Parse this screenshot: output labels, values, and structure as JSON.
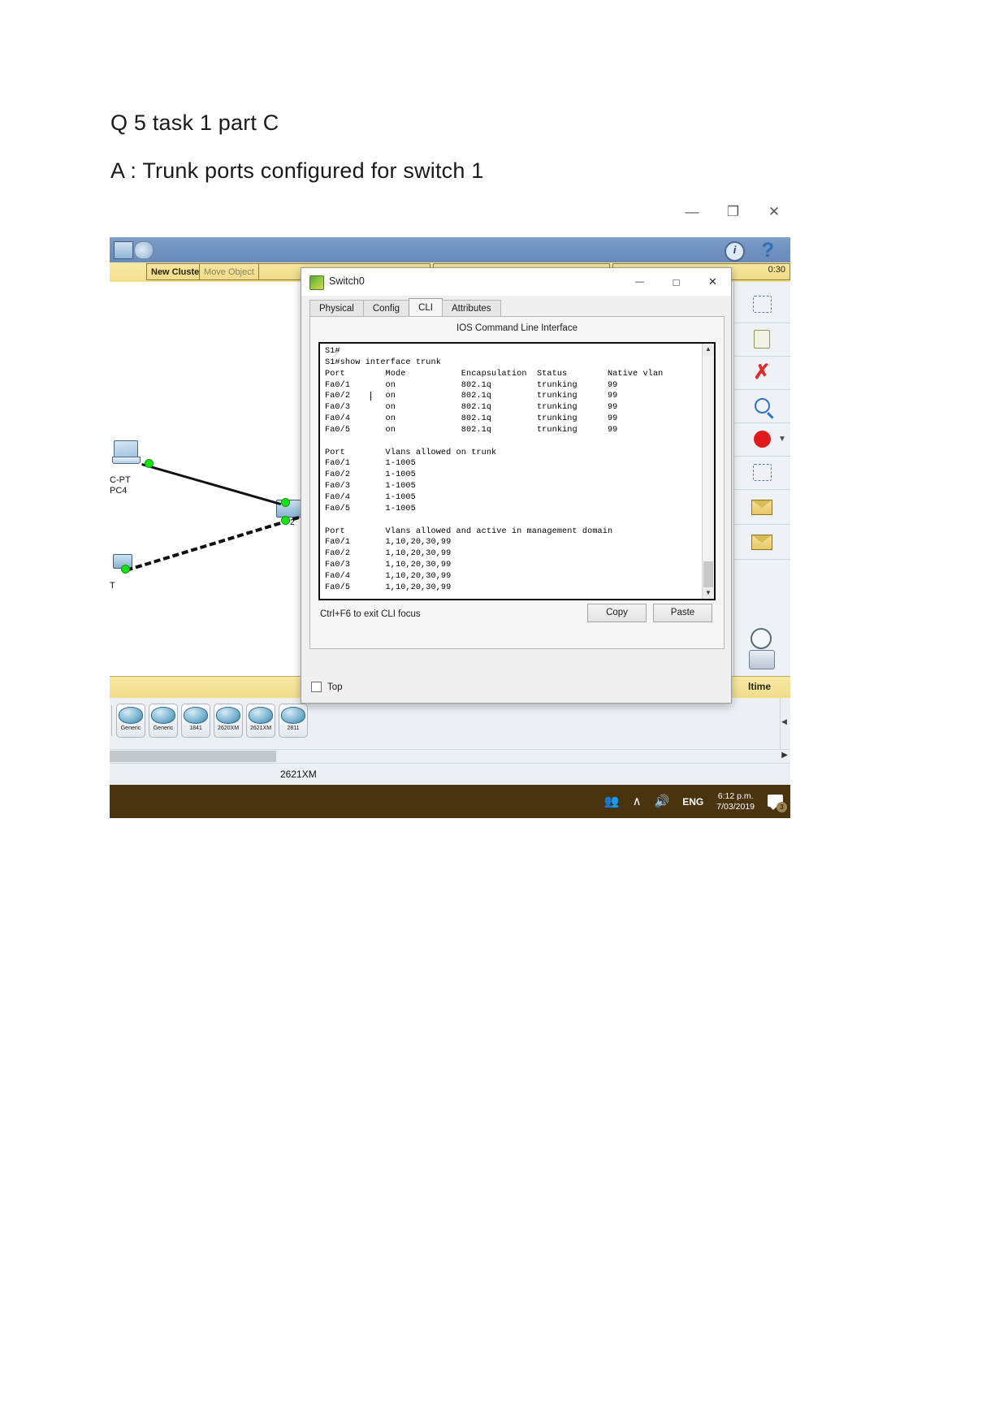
{
  "document": {
    "heading_1": "Q 5 task 1 part C",
    "heading_2": "A : Trunk ports configured for switch 1"
  },
  "os_window": {
    "minimize": "—",
    "restore": "❐",
    "close": "✕"
  },
  "packet_tracer": {
    "cluster_bar": {
      "new_cluster": "New Cluster",
      "move_object": "Move Object",
      "clock": "0:30"
    },
    "topology": {
      "pc_label_line1": "C-PT",
      "pc_label_line2": "PC4",
      "device_label": "T",
      "switch_port_label": "2"
    },
    "right_panel_icons": [
      "select-box-icon",
      "note-icon",
      "delete-x-icon",
      "inspect-magnifier-icon",
      "resize-shape-icon",
      "dashed-rectangle-icon",
      "add-simple-pdu-icon",
      "add-complex-pdu-icon",
      "camera-icon",
      "clock-icon"
    ],
    "workspace_mode": "ltime",
    "device_strip": [
      {
        "label": "Generic"
      },
      {
        "label": "Generic"
      },
      {
        "label": "1841"
      },
      {
        "label": "2620XM"
      },
      {
        "label": "2621XM"
      },
      {
        "label": "2811"
      }
    ],
    "status_device": "2621XM"
  },
  "switch_dialog": {
    "title": "Switch0",
    "tabs": [
      {
        "label": "Physical",
        "active": false
      },
      {
        "label": "Config",
        "active": false
      },
      {
        "label": "CLI",
        "active": true
      },
      {
        "label": "Attributes",
        "active": false
      }
    ],
    "cli_heading": "IOS Command Line Interface",
    "cli_output": "S1#\nS1#show interface trunk\nPort        Mode           Encapsulation  Status        Native vlan\nFa0/1       on             802.1q         trunking      99\nFa0/2       on             802.1q         trunking      99\nFa0/3       on             802.1q         trunking      99\nFa0/4       on             802.1q         trunking      99\nFa0/5       on             802.1q         trunking      99\n\nPort        Vlans allowed on trunk\nFa0/1       1-1005\nFa0/2       1-1005\nFa0/3       1-1005\nFa0/4       1-1005\nFa0/5       1-1005\n\nPort        Vlans allowed and active in management domain\nFa0/1       1,10,20,30,99\nFa0/2       1,10,20,30,99\nFa0/3       1,10,20,30,99\nFa0/4       1,10,20,30,99\nFa0/5       1,10,20,30,99\n\nPort        Vlans in spanning tree forwarding state and not\npruned",
    "hint": "Ctrl+F6 to exit CLI focus",
    "copy_button": "Copy",
    "paste_button": "Paste",
    "top_checkbox_label": "Top"
  },
  "taskbar": {
    "people_icon": "people-icon",
    "chevron_up": "∧",
    "volume_icon": "volume-icon",
    "language": "ENG",
    "time": "6:12 p.m.",
    "date": "7/03/2019",
    "action_center_badge": "3"
  },
  "colors": {
    "taskbar_bg": "#4a3410",
    "pt_blue": "#6f90bf",
    "pt_yellow": "#f2df8f",
    "accent_red": "#e0191d"
  }
}
